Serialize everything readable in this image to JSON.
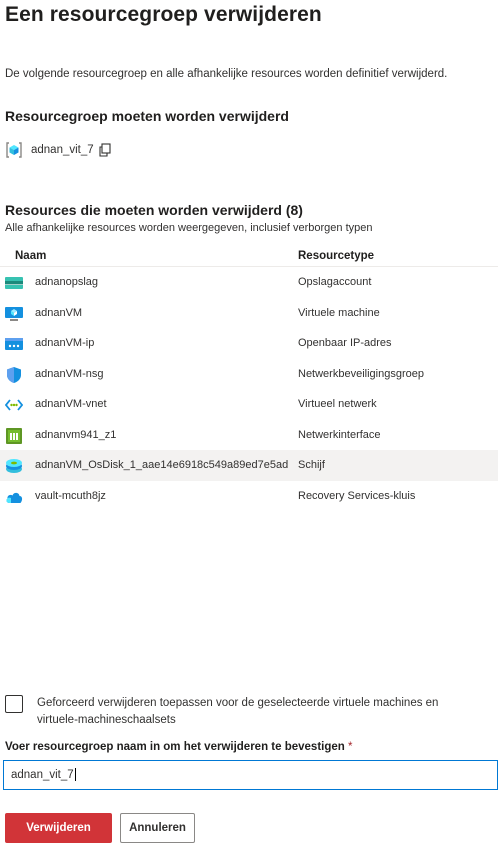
{
  "title": "Een resourcegroep verwijderen",
  "description": "De volgende resourcegroep en alle afhankelijke resources worden definitief verwijderd.",
  "rg_section": {
    "heading": "Resourcegroep moeten worden verwijderd",
    "name": "adnan_vit_7",
    "icon": "resource-group-icon",
    "copy_icon": "copy-icon"
  },
  "resources_section": {
    "heading": "Resources die moeten worden verwijderd (8)",
    "subtext": "Alle afhankelijke resources worden weergegeven, inclusief verborgen typen",
    "columns": {
      "name": "Naam",
      "type": "Resourcetype"
    },
    "rows": [
      {
        "name": "adnanopslag",
        "type": "Opslagaccount",
        "icon": "storage-account-icon"
      },
      {
        "name": "adnanVM",
        "type": "Virtuele machine",
        "icon": "virtual-machine-icon"
      },
      {
        "name": "adnanVM-ip",
        "type": "Openbaar IP-adres",
        "icon": "public-ip-icon"
      },
      {
        "name": "adnanVM-nsg",
        "type": "Netwerkbeveiligingsgroep",
        "icon": "network-security-group-icon"
      },
      {
        "name": "adnanVM-vnet",
        "type": "Virtueel netwerk",
        "icon": "virtual-network-icon"
      },
      {
        "name": "adnanvm941_z1",
        "type": "Netwerkinterface",
        "icon": "network-interface-icon"
      },
      {
        "name": "adnanVM_OsDisk_1_aae14e6918c549a89ed7e5ad",
        "type": "Schijf",
        "icon": "disk-icon"
      },
      {
        "name": "vault-mcuth8jz",
        "type": "Recovery Services-kluis",
        "icon": "recovery-vault-icon"
      }
    ]
  },
  "force_delete": {
    "label": "Geforceerd verwijderen toepassen voor de geselecteerde virtuele machines en virtuele-machineschaalsets",
    "checked": false
  },
  "confirm": {
    "label": "Voer resourcegroep naam in om het verwijderen te bevestigen",
    "required_mark": "*",
    "value": "adnan_vit_7"
  },
  "buttons": {
    "delete": "Verwijderen",
    "cancel": "Annuleren"
  },
  "colors": {
    "danger": "#d13438",
    "accent": "#0078d4",
    "highlight_row": "#f3f2f1"
  }
}
